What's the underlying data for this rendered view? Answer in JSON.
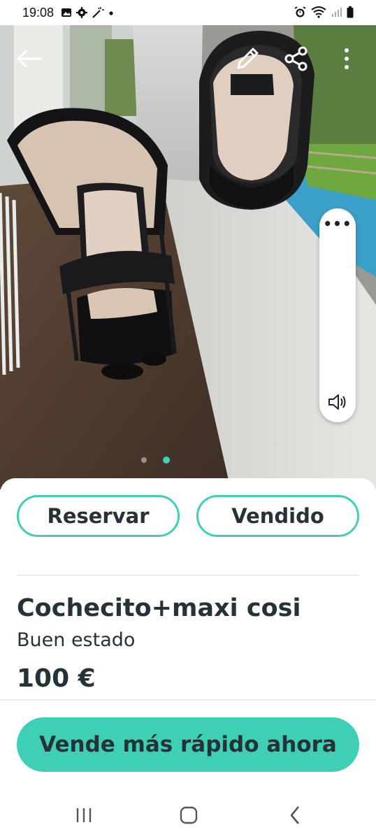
{
  "status_bar": {
    "time": "19:08",
    "left_icons": [
      "gallery-icon",
      "settings-icon",
      "magic-wand-icon",
      "dot-icon"
    ],
    "right_icons": [
      "alarm-icon",
      "wifi-icon",
      "signal-icon",
      "battery-icon"
    ]
  },
  "hero": {
    "photo_description_icon": "stroller-photo",
    "actions": [
      "back-arrow-icon",
      "edit-pencil-icon",
      "share-icon",
      "more-vert-icon"
    ],
    "carousel": {
      "total": 2,
      "active": 2
    }
  },
  "volume_panel": {
    "more_label": "•••",
    "icon": "speaker-icon"
  },
  "listing": {
    "reserve_label": "Reservar",
    "sold_label": "Vendido",
    "title": "Cochecito+maxi cosi",
    "condition": "Buen estado",
    "price": "100 €",
    "cta_label": "Vende más rápido ahora"
  },
  "colors": {
    "accent": "#3fcfb4",
    "text": "#253238"
  },
  "nav": {
    "buttons": [
      "recents-icon",
      "home-icon",
      "back-icon"
    ]
  }
}
